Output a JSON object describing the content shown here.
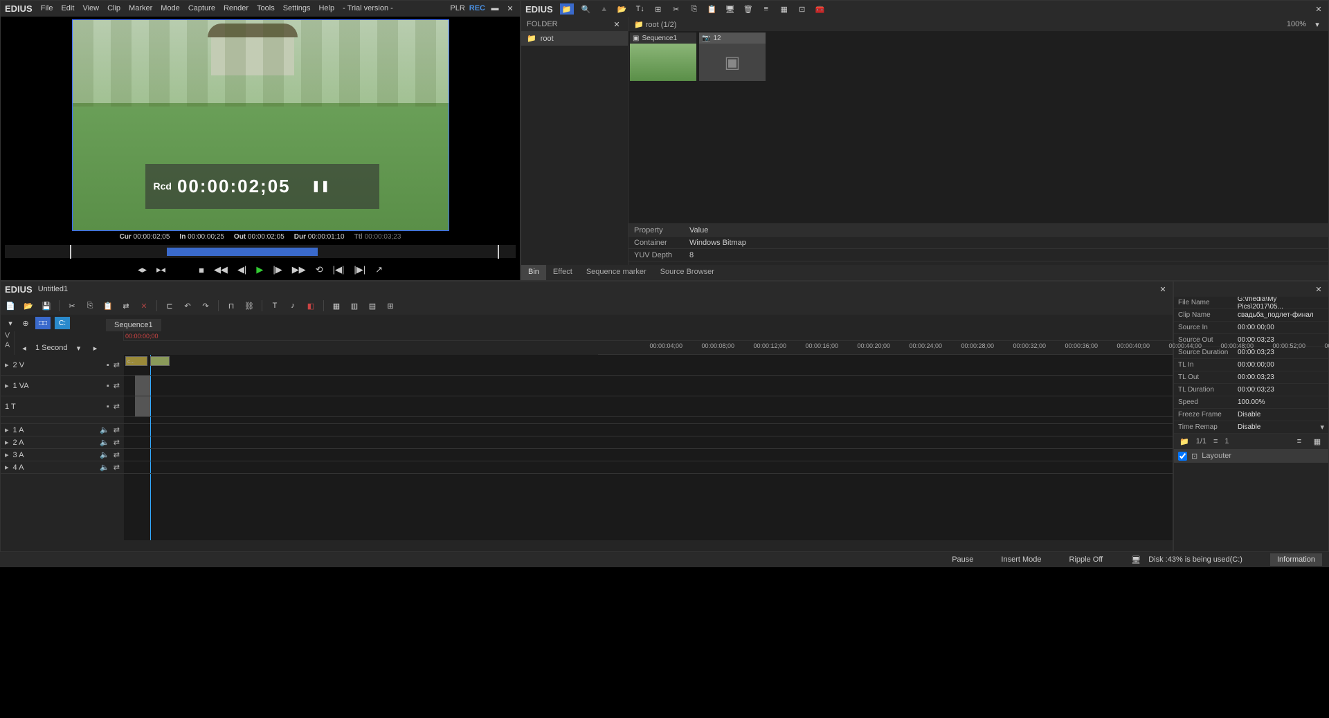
{
  "app_name": "EDIUS",
  "menu": [
    "File",
    "Edit",
    "View",
    "Clip",
    "Marker",
    "Mode",
    "Capture",
    "Render",
    "Tools",
    "Settings",
    "Help"
  ],
  "trial_label": "- Trial version -",
  "plr_label": "PLR",
  "rec_label": "REC",
  "preview": {
    "rcd_label": "Rcd",
    "timecode": "00:00:02;05",
    "cur_label": "Cur",
    "cur": "00:00:02;05",
    "in_label": "In",
    "in": "00:00:00;25",
    "out_label": "Out",
    "out": "00:00:02;05",
    "dur_label": "Dur",
    "dur": "00:00:01;10",
    "ttl_label": "Ttl",
    "ttl": "00:00:03;23"
  },
  "bin": {
    "folder_header": "FOLDER",
    "root_label": "root",
    "path_label": "root (1/2)",
    "zoom": "100%",
    "clips": [
      {
        "name": "Sequence1"
      },
      {
        "name": "12"
      }
    ],
    "property_header": "Property",
    "value_header": "Value",
    "props": [
      {
        "key": "Container",
        "val": "Windows Bitmap"
      },
      {
        "key": "YUV Depth",
        "val": "8"
      }
    ],
    "tabs": [
      "Bin",
      "Effect",
      "Sequence marker",
      "Source Browser"
    ]
  },
  "timeline": {
    "title": "Untitled1",
    "sequence_tab": "Sequence1",
    "scale_label": "1 Second",
    "va_v": "V",
    "va_a": "A",
    "ruler": [
      "00:00:00;00",
      "00:00:04;00",
      "00:00:08;00",
      "00:00:12;00",
      "00:00:16;00",
      "00:00:20;00",
      "00:00:24;00",
      "00:00:28;00",
      "00:00:32;00",
      "00:00:36;00",
      "00:00:40;00",
      "00:00:44;00",
      "00:00:48;00",
      "00:00:52;00",
      "00:00:..."
    ],
    "tracks": [
      "2 V",
      "1 VA",
      "1 T",
      "1 A",
      "2 A",
      "3 A",
      "4 A"
    ],
    "clip_label": "с..."
  },
  "info": {
    "rows": [
      {
        "key": "File Name",
        "val": "G:\\media\\My Pics\\2017\\05..."
      },
      {
        "key": "Clip Name",
        "val": "свадьба_подлет-финал"
      },
      {
        "key": "Source In",
        "val": "00:00:00;00"
      },
      {
        "key": "Source Out",
        "val": "00:00:03;23"
      },
      {
        "key": "Source Duration",
        "val": "00:00:03;23"
      },
      {
        "key": "TL In",
        "val": "00:00:00;00"
      },
      {
        "key": "TL Out",
        "val": "00:00:03;23"
      },
      {
        "key": "TL Duration",
        "val": "00:00:03;23"
      },
      {
        "key": "Speed",
        "val": "100.00%"
      },
      {
        "key": "Freeze Frame",
        "val": "Disable"
      },
      {
        "key": "Time Remap",
        "val": "Disable"
      }
    ],
    "footer_page": "1/1",
    "footer_count": "1",
    "layouter": "Layouter",
    "tab": "Information"
  },
  "status": {
    "pause": "Pause",
    "insert": "Insert Mode",
    "ripple": "Ripple Off",
    "disk": "Disk :43% is being used(C:)"
  }
}
